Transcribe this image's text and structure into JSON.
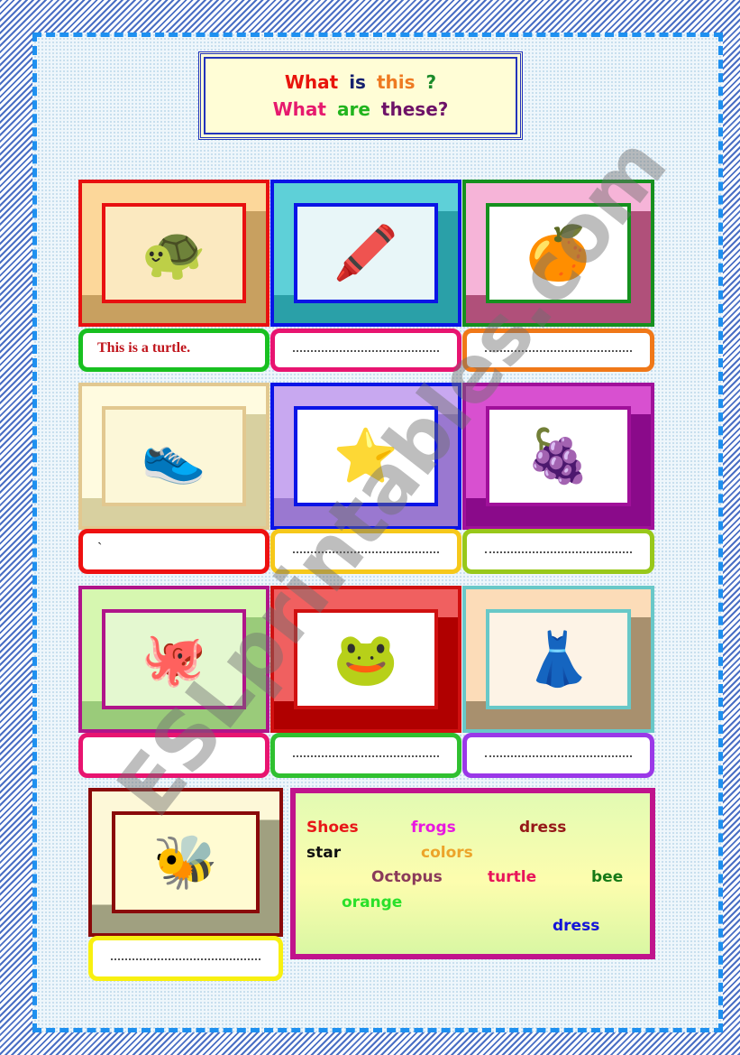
{
  "title": {
    "line1": [
      {
        "text": "What",
        "color": "#e8140c"
      },
      {
        "text": "is",
        "color": "#14206e"
      },
      {
        "text": "this",
        "color": "#ee7a22"
      },
      {
        "text": "?",
        "color": "#1a8a2a"
      }
    ],
    "line2": [
      {
        "text": "What",
        "color": "#e61a6e"
      },
      {
        "text": "are",
        "color": "#22b41e"
      },
      {
        "text": "these?",
        "color": "#6e1268"
      }
    ]
  },
  "cards": [
    {
      "name": "turtle",
      "icon": "turtle-icon",
      "glyph": "🐢",
      "frame_color": "#e81010",
      "bevel_top": "#fcd79a",
      "bevel_side": "#c8a060",
      "inner_bg": "#fbe9c0",
      "answer_border": "#18c020",
      "answer_text": "This  is  a turtle.",
      "blank": false
    },
    {
      "name": "colors",
      "icon": "crayons-icon",
      "glyph": "🖍️",
      "frame_color": "#0a14e6",
      "bevel_top": "#5ed0d8",
      "bevel_side": "#2aa0a8",
      "inner_bg": "#e8f6f8",
      "answer_border": "#e81470",
      "answer_text": "",
      "blank": true
    },
    {
      "name": "orange",
      "icon": "orange-icon",
      "glyph": "🍊",
      "frame_color": "#15901e",
      "bevel_top": "#f6b4d8",
      "bevel_side": "#b0507a",
      "inner_bg": "#ffffff",
      "answer_border": "#f07818",
      "answer_text": "",
      "blank": true
    },
    {
      "name": "shoes",
      "icon": "shoes-icon",
      "glyph": "👟",
      "frame_color": "#e2c890",
      "bevel_top": "#fffbe0",
      "bevel_side": "#d8d0a0",
      "inner_bg": "#fcf7d8",
      "answer_border": "#ee1010",
      "answer_text": "`",
      "blank": false
    },
    {
      "name": "star",
      "icon": "starfish-icon",
      "glyph": "⭐",
      "frame_color": "#0a14e6",
      "bevel_top": "#c8a8f0",
      "bevel_side": "#9a78d0",
      "inner_bg": "#ffffff",
      "answer_border": "#f6c81a",
      "answer_text": "",
      "blank": true
    },
    {
      "name": "grapes",
      "icon": "grapes-icon",
      "glyph": "🍇",
      "frame_color": "#a0109a",
      "bevel_top": "#d850d0",
      "bevel_side": "#8a0a8a",
      "inner_bg": "#ffffff",
      "answer_border": "#98c81a",
      "answer_text": "",
      "blank": true
    },
    {
      "name": "octopus",
      "icon": "octopus-icon",
      "glyph": "🐙",
      "frame_color": "#b0148a",
      "bevel_top": "#d6f7b0",
      "bevel_side": "#9acb7a",
      "inner_bg": "#e4f8d0",
      "answer_border": "#e81470",
      "answer_text": "",
      "blank": false
    },
    {
      "name": "frogs",
      "icon": "frogs-icon",
      "glyph": "🐸",
      "frame_color": "#d01010",
      "bevel_top": "#f06060",
      "bevel_side": "#b00000",
      "inner_bg": "#ffffff",
      "answer_border": "#30c030",
      "answer_text": "",
      "blank": true
    },
    {
      "name": "dress",
      "icon": "dress-icon",
      "glyph": "👗",
      "frame_color": "#68c8c8",
      "bevel_top": "#fcdcb8",
      "bevel_side": "#a8906e",
      "inner_bg": "#fdf3e6",
      "answer_border": "#9a38e8",
      "answer_text": "",
      "blank": true
    },
    {
      "name": "bee",
      "icon": "bee-icon",
      "glyph": "🐝",
      "frame_color": "#8a0a0a",
      "bevel_top": "#fdf8d8",
      "bevel_side": "#a0a080",
      "inner_bg": "#fffbd2",
      "answer_border": "#f8f010",
      "answer_text": "",
      "blank": true
    }
  ],
  "word_bank": [
    {
      "text": "Shoes",
      "color": "#e81818"
    },
    {
      "text": "frogs",
      "color": "#e818e0"
    },
    {
      "text": "dress",
      "color": "#961818"
    },
    {
      "text": "star",
      "color": "#101010"
    },
    {
      "text": "colors",
      "color": "#eca42a"
    },
    {
      "text": "Octopus",
      "color": "#8a3a5a"
    },
    {
      "text": "turtle",
      "color": "#e8145a"
    },
    {
      "text": "bee",
      "color": "#167a16"
    },
    {
      "text": "orange",
      "color": "#2ae02a"
    },
    {
      "text": "dress",
      "color": "#1414d8"
    }
  ],
  "watermark": "ESLprintables.com"
}
